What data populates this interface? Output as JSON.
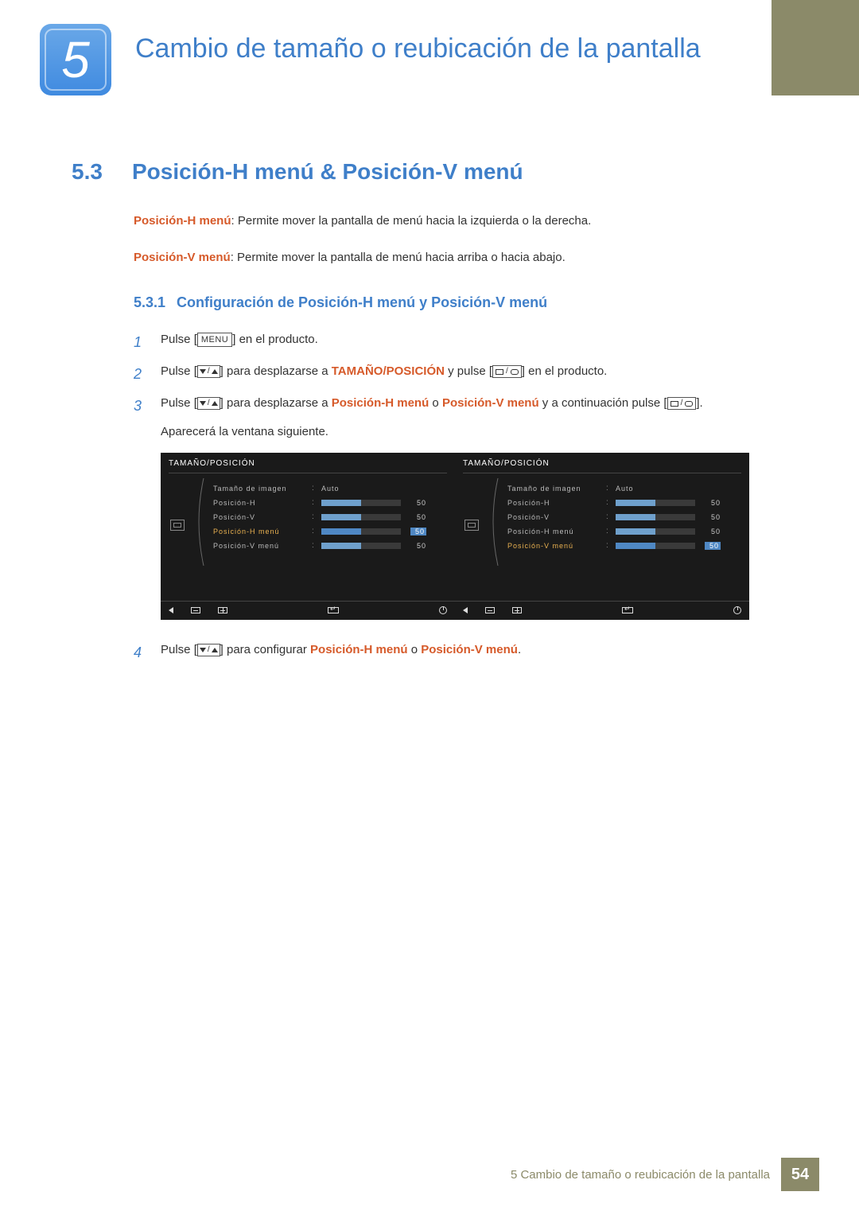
{
  "chapter": {
    "number": "5",
    "title": "Cambio de tamaño o reubicación de la pantalla"
  },
  "section": {
    "number": "5.3",
    "title": "Posición-H menú & Posición-V menú"
  },
  "para1": {
    "kw": "Posición-H menú",
    "rest": ": Permite mover la pantalla de menú hacia la izquierda o la derecha."
  },
  "para2": {
    "kw": "Posición-V menú",
    "rest": ": Permite mover la pantalla de menú hacia arriba o hacia abajo."
  },
  "subsection": {
    "number": "5.3.1",
    "title": "Configuración de Posición-H menú y Posición-V menú"
  },
  "steps": {
    "s1": {
      "num": "1",
      "a": "Pulse [",
      "menu": "MENU",
      "b": "] en el producto."
    },
    "s2": {
      "num": "2",
      "a": "Pulse [",
      "b": "] para desplazarse a ",
      "kw": "TAMAÑO/POSICIÓN",
      "c": " y pulse [",
      "d": "] en el producto."
    },
    "s3": {
      "num": "3",
      "a": "Pulse [",
      "b": "] para desplazarse a ",
      "kw1": "Posición-H menú",
      "mid": " o ",
      "kw2": "Posición-V menú",
      "c": " y a continuación pulse [",
      "d": "]."
    },
    "s4": {
      "num": "4",
      "a": "Pulse [",
      "b": "] para configurar ",
      "kw1": "Posición-H menú",
      "mid": " o ",
      "kw2": "Posición-V menú",
      "c": "."
    }
  },
  "note_after_s3": "Aparecerá la ventana siguiente.",
  "osd": {
    "title": "TAMAÑO/POSICIÓN",
    "rows": {
      "r0": {
        "label": "Tamaño de imagen",
        "value": "Auto"
      },
      "r1": {
        "label": "Posición-H",
        "num": "50",
        "fill": 50
      },
      "r2": {
        "label": "Posición-V",
        "num": "50",
        "fill": 50
      },
      "r3": {
        "label": "Posición-H menú",
        "num": "50",
        "fill": 50
      },
      "r4": {
        "label": "Posición-V menú",
        "num": "50",
        "fill": 50
      }
    }
  },
  "footer": {
    "text": "5 Cambio de tamaño o reubicación de la pantalla",
    "page": "54"
  }
}
